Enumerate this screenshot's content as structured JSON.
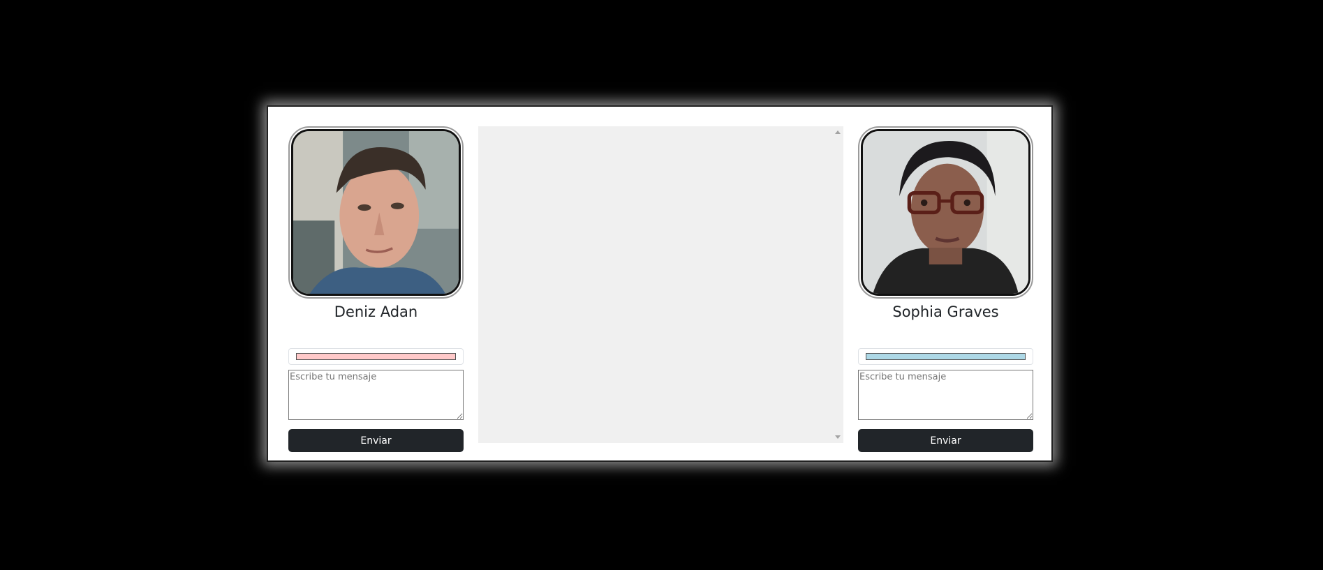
{
  "users": [
    {
      "name": "Deniz Adan",
      "color": "#ffc9c9",
      "message_placeholder": "Escribe tu mensaje",
      "send_label": "Enviar"
    },
    {
      "name": "Sophia Graves",
      "color": "#add8e6",
      "message_placeholder": "Escribe tu mensaje",
      "send_label": "Enviar"
    }
  ],
  "icons": {
    "scroll_up": "scroll-up-arrow-icon",
    "scroll_down": "scroll-down-arrow-icon"
  }
}
